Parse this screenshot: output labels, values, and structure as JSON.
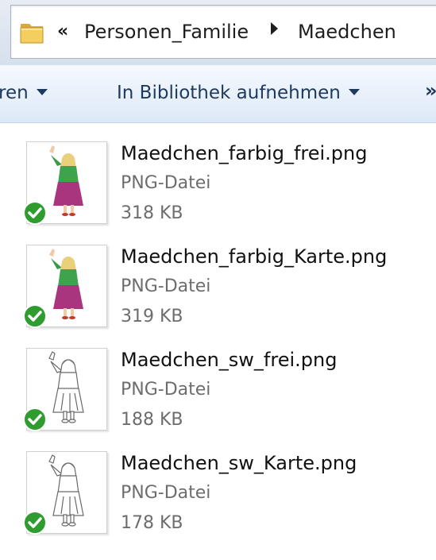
{
  "breadcrumb": {
    "overflow_glyph": "«",
    "items": [
      "Personen_Familie",
      "Maedchen"
    ]
  },
  "toolbar": {
    "organize_label": "ren",
    "library_label": "In Bibliothek aufnehmen",
    "more_glyph": "»"
  },
  "files": [
    {
      "name": "Maedchen_farbig_frei.png",
      "type": "PNG-Datei",
      "size": "318 KB",
      "thumbnail": "colored",
      "status": "synced"
    },
    {
      "name": "Maedchen_farbig_Karte.png",
      "type": "PNG-Datei",
      "size": "319 KB",
      "thumbnail": "colored",
      "status": "synced"
    },
    {
      "name": "Maedchen_sw_frei.png",
      "type": "PNG-Datei",
      "size": "188 KB",
      "thumbnail": "black-and-white",
      "status": "synced"
    },
    {
      "name": "Maedchen_sw_Karte.png",
      "type": "PNG-Datei",
      "size": "178 KB",
      "thumbnail": "black-and-white",
      "status": "synced"
    }
  ],
  "colors": {
    "toolbar_text": "#1e395b",
    "secondary_text": "#6d6d6d",
    "sync_badge": "#2e9c2e"
  },
  "icons": {
    "address_folder": "folder-icon",
    "status": "green-check-sync-icon",
    "thumbnail": "girl-figure-thumbnail"
  }
}
